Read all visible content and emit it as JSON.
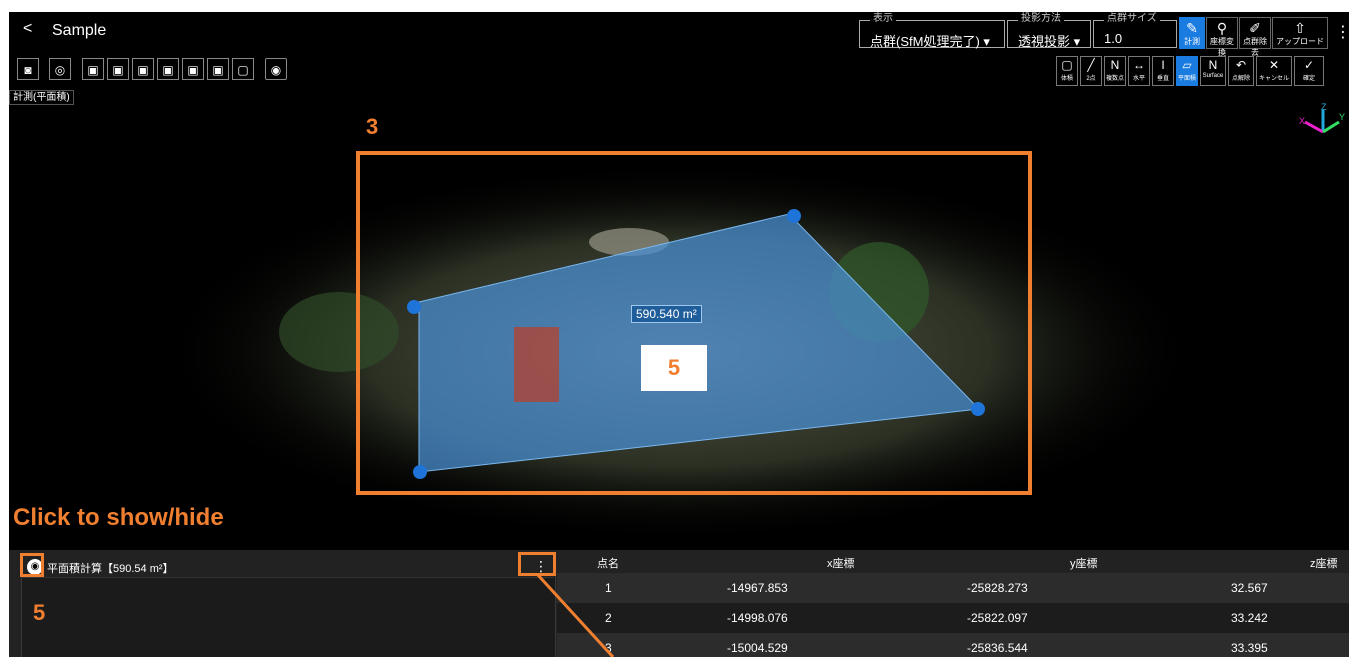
{
  "header": {
    "back_symbol": "<",
    "title": "Sample",
    "display": {
      "label": "表示",
      "value": "点群(SfM処理完了)"
    },
    "projection": {
      "label": "投影方法",
      "value": "透視投影"
    },
    "point_size": {
      "label": "点群サイズ",
      "value": "1.0"
    },
    "tools": [
      {
        "name": "measure",
        "label": "計測",
        "icon": "ruler-icon",
        "active": true
      },
      {
        "name": "coordinate-transform",
        "label": "座標変換",
        "icon": "transform-icon",
        "active": false
      },
      {
        "name": "point-removal",
        "label": "点群除去",
        "icon": "eraser-icon",
        "active": false
      },
      {
        "name": "upload",
        "label": "アップロード",
        "icon": "upload-icon",
        "active": false
      }
    ],
    "more_symbol": "⋮"
  },
  "view_toolbar": {
    "buttons": [
      "camera-icon",
      "target-icon",
      "view-cube-1-icon",
      "view-cube-2-icon",
      "view-cube-3-icon",
      "view-cube-4-icon",
      "view-cube-5-icon",
      "view-cube-6-icon",
      "view-square-icon",
      "eye-icon"
    ]
  },
  "measure_label": "計測(平面積)",
  "measure_toolbar": [
    {
      "name": "volume",
      "label": "体積",
      "icon": "volume-icon"
    },
    {
      "name": "two-point",
      "label": "2点",
      "icon": "line-icon"
    },
    {
      "name": "multi-point",
      "label": "複数点",
      "icon": "polyline-icon"
    },
    {
      "name": "horizontal",
      "label": "水平",
      "icon": "horizontal-icon"
    },
    {
      "name": "vertical",
      "label": "垂直",
      "icon": "vertical-icon"
    },
    {
      "name": "plane-area",
      "label": "平面積",
      "icon": "plane-icon",
      "active": true
    },
    {
      "name": "surface",
      "label": "Surface",
      "icon": "surface-icon"
    },
    {
      "name": "release-point",
      "label": "点解除",
      "icon": "undo-icon"
    },
    {
      "name": "cancel",
      "label": "キャンセル",
      "icon": "close-icon"
    },
    {
      "name": "confirm",
      "label": "確定",
      "icon": "check-icon"
    }
  ],
  "annotations": {
    "frame_number": "3",
    "inner_number": "5",
    "click_hint": "Click to show/hide",
    "panel_number": "5"
  },
  "area_measurement": "590.540 m²",
  "axes": {
    "x": "X",
    "y": "Y",
    "z": "Z"
  },
  "panel": {
    "entry_label": "平面積計算【590.54 m²】",
    "kebab_symbol": "⋮",
    "columns": [
      "点名",
      "x座標",
      "y座標",
      "z座標"
    ],
    "rows": [
      {
        "name": "1",
        "x": "-14967.853",
        "y": "-25828.273",
        "z": "32.567"
      },
      {
        "name": "2",
        "x": "-14998.076",
        "y": "-25822.097",
        "z": "33.242"
      },
      {
        "name": "3",
        "x": "-15004.529",
        "y": "-25836.544",
        "z": "33.395"
      }
    ]
  },
  "colors": {
    "accent": "#f07f30",
    "active": "#1a7be0",
    "area_fill": "#4a90d6"
  }
}
